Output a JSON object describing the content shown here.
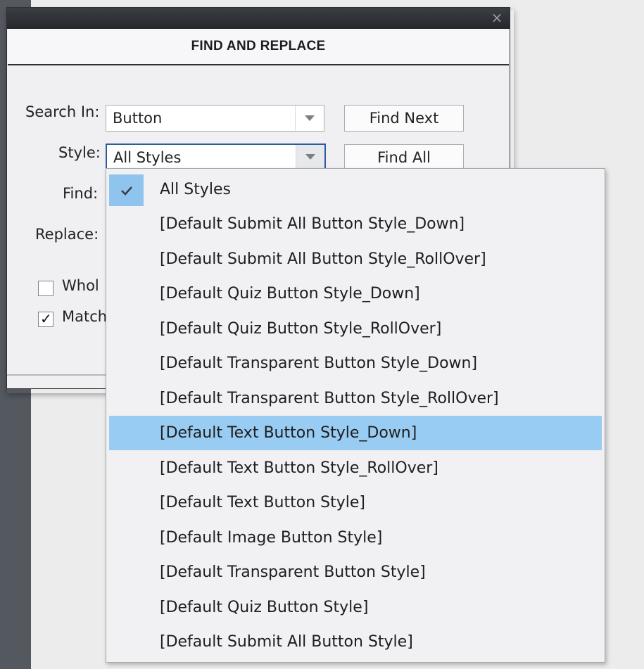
{
  "dialog": {
    "title": "FIND AND REPLACE",
    "close_symbol": "×"
  },
  "form": {
    "search_in": {
      "label": "Search In:",
      "value": "Button"
    },
    "style": {
      "label": "Style:",
      "value": "All Styles"
    },
    "find": {
      "label": "Find:"
    },
    "replace": {
      "label": "Replace:"
    },
    "buttons": {
      "find_next": "Find Next",
      "find_all": "Find All"
    },
    "options": [
      {
        "label": "Whol",
        "checked": false
      },
      {
        "label": "Match",
        "checked": true
      }
    ]
  },
  "dropdown": {
    "selected_index": 0,
    "hover_index": 7,
    "items": [
      "All Styles",
      "[Default Submit All Button Style_Down]",
      "[Default Submit All Button Style_RollOver]",
      "[Default Quiz Button Style_Down]",
      "[Default Quiz Button Style_RollOver]",
      "[Default Transparent Button Style_Down]",
      "[Default Transparent Button Style_RollOver]",
      "[Default Text Button Style_Down]",
      "[Default Text Button Style_RollOver]",
      "[Default Text Button Style]",
      "[Default Image Button Style]",
      "[Default Transparent Button Style]",
      "[Default Quiz Button Style]",
      "[Default Submit All Button Style]"
    ]
  },
  "colors": {
    "highlight": "#99ccf2",
    "check_cell": "#8fc4ee",
    "focus_border": "#2c5c99",
    "titlebar": "#2e3033"
  },
  "icons": {
    "close": "close-icon",
    "dropdown_arrow": "chevron-down-icon",
    "selected_check": "check-icon"
  }
}
